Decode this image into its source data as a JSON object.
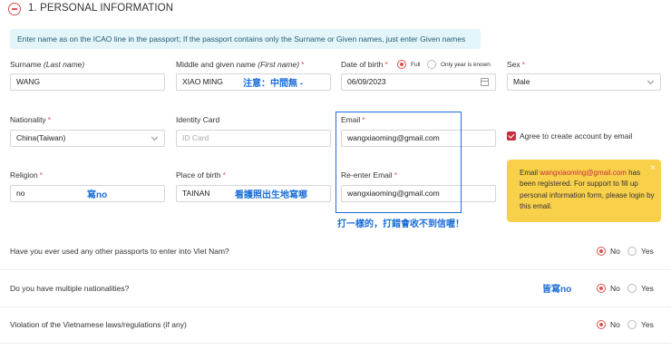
{
  "section": {
    "title": "1. PERSONAL INFORMATION"
  },
  "notice": "Enter name as on the ICAO line in the passport; If the passport contains only the Surname or Given names, just enter Given names",
  "fields": {
    "surname": {
      "label": "Surname",
      "label_hint": "(Last name)",
      "value": "WANG"
    },
    "given_name": {
      "label": "Middle and given name",
      "label_hint": "(First name)",
      "value": "XIAO MING"
    },
    "dob": {
      "label": "Date of birth",
      "value": "06/09/2023",
      "opt_full": "Full",
      "opt_year": "Only year is known"
    },
    "sex": {
      "label": "Sex",
      "value": "Male"
    },
    "nationality": {
      "label": "Nationality",
      "value": "China(Taiwan)"
    },
    "identity_card": {
      "label": "Identity Card",
      "placeholder": "ID Card"
    },
    "email": {
      "label": "Email",
      "value": "wangxiaoming@gmail.com"
    },
    "religion": {
      "label": "Religion",
      "value": "no"
    },
    "place_of_birth": {
      "label": "Place of birth",
      "value": "TAINAN"
    },
    "reenter_email": {
      "label": "Re-enter Email",
      "value": "wangxiaoming@gmail.com"
    }
  },
  "agree": {
    "label": "Agree to create account by email",
    "checked": true
  },
  "alert": {
    "prefix": "Email ",
    "email": "wangxiaoming@gmail.com",
    "text": " has been registered. For support to fill up personal information form, please login by this email.",
    "close": "×"
  },
  "questions": [
    {
      "text": "Have you ever used any other passports to enter into Viet Nam?",
      "yes": "Yes",
      "no": "No",
      "selected": "No"
    },
    {
      "text": "Do you have multiple nationalities?",
      "yes": "Yes",
      "no": "No",
      "selected": "No"
    },
    {
      "text": "Violation of the Vietnamese laws/regulations (if any)",
      "yes": "Yes",
      "no": "No",
      "selected": "No"
    }
  ],
  "annotations": {
    "given_name": "注意：中間無 -",
    "religion": "寫no",
    "place_of_birth": "看護照出生地寫哪",
    "email": "打一樣的，打錯會收不到信喔！",
    "questions": "皆寫no"
  },
  "colors": {
    "accent": "#d9534f",
    "annotation": "#1a6ed8",
    "alert_bg": "#f9d04a",
    "notice_bg": "#e4f5fa"
  }
}
